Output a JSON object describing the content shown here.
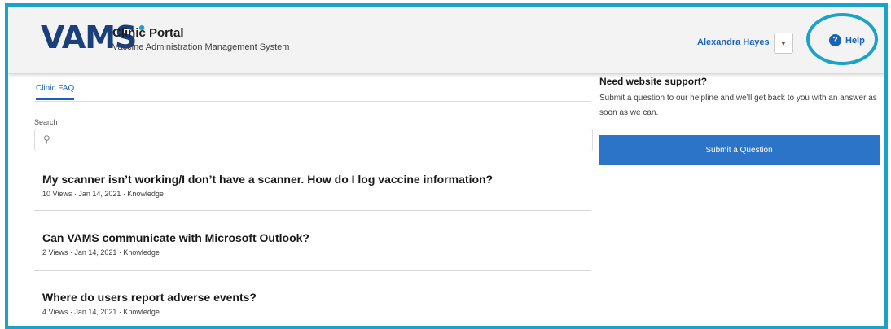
{
  "header": {
    "logo_text": "VAMS",
    "logo_mark": "•",
    "portal_title": "Clinic Portal",
    "portal_subtitle": "Vaccine Administration Management System",
    "user_name": "Alexandra Hayes",
    "user_menu_icon": "chevron-down-icon",
    "help_label": "Help",
    "help_icon": "question-circle-icon"
  },
  "tabs": [
    {
      "label": "Clinic FAQ",
      "active": true
    }
  ],
  "search": {
    "label": "Search",
    "placeholder": "",
    "icon": "search-icon"
  },
  "articles": [
    {
      "title": "My scanner isn’t working/I don’t have a scanner. How do I log vaccine information?",
      "meta": "10 Views  ·  Jan 14, 2021  ·  Knowledge"
    },
    {
      "title": "Can VAMS communicate with Microsoft Outlook?",
      "meta": "2 Views  ·  Jan 14, 2021  ·  Knowledge"
    },
    {
      "title": "Where do users report adverse events?",
      "meta": "4 Views  ·  Jan 14, 2021  ·  Knowledge"
    }
  ],
  "support": {
    "title": "Need website support?",
    "text": "Submit a question to our helpline and we’ll get back to you with an answer as soon as we can.",
    "button_label": "Submit a Question"
  },
  "colors": {
    "accent": "#1a62b5",
    "highlight": "#1aa3c9",
    "button": "#2c74c8",
    "logo": "#1a3f7a"
  }
}
